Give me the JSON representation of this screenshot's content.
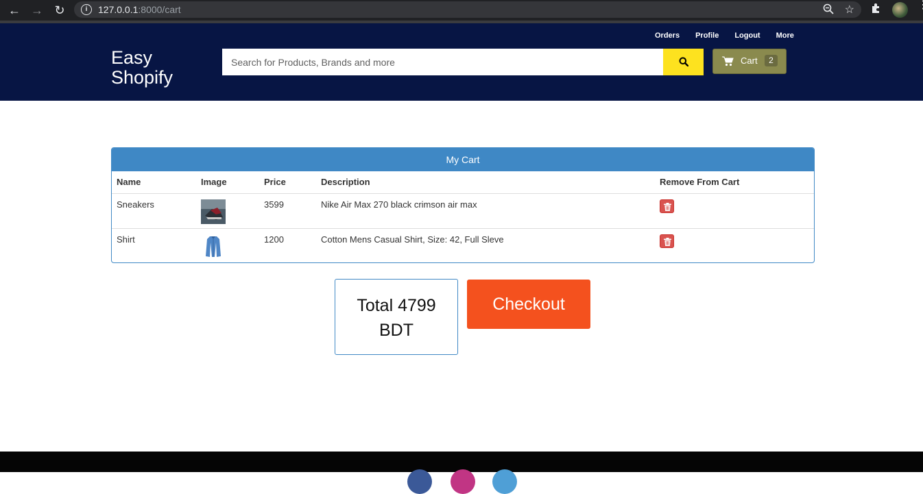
{
  "browser": {
    "url_host": "127.0.0.1",
    "url_rest": ":8000/cart"
  },
  "header": {
    "brand_line1": "Easy",
    "brand_line2": "Shopify",
    "nav": [
      "Orders",
      "Profile",
      "Logout",
      "More"
    ],
    "search_placeholder": "Search for Products, Brands and more",
    "cart_label": "Cart",
    "cart_count": "2"
  },
  "cart": {
    "title": "My Cart",
    "columns": [
      "Name",
      "Image",
      "Price",
      "Description",
      "Remove From Cart"
    ],
    "rows": [
      {
        "name": "Sneakers",
        "price": "3599",
        "description": "Nike Air Max 270 black crimson air max"
      },
      {
        "name": "Shirt",
        "price": "1200",
        "description": "Cotton Mens Casual Shirt, Size: 42, Full Sleve"
      }
    ]
  },
  "summary": {
    "total_line1": "Total 4799",
    "total_line2": "BDT",
    "checkout_label": "Checkout"
  },
  "colors": {
    "header_bg": "#071544",
    "search_button": "#fde21f",
    "cart_button": "#8a8a4e",
    "panel_accent": "#3f88c5",
    "checkout": "#f4511e",
    "remove": "#d9534f"
  }
}
